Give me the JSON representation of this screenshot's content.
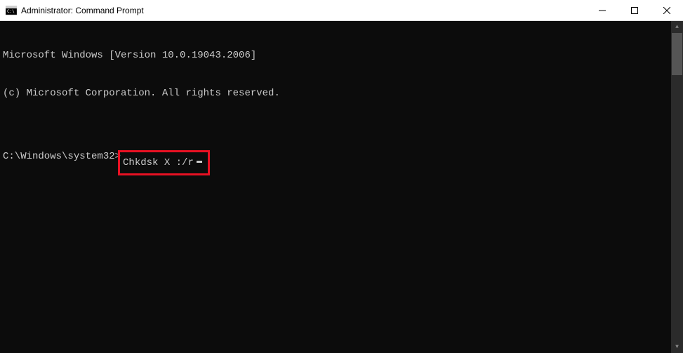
{
  "titlebar": {
    "title": "Administrator: Command Prompt"
  },
  "terminal": {
    "line1": "Microsoft Windows [Version 10.0.19043.2006]",
    "line2": "(c) Microsoft Corporation. All rights reserved.",
    "blank": "",
    "prompt": "C:\\Windows\\system32>",
    "command": "Chkdsk X :/r"
  }
}
